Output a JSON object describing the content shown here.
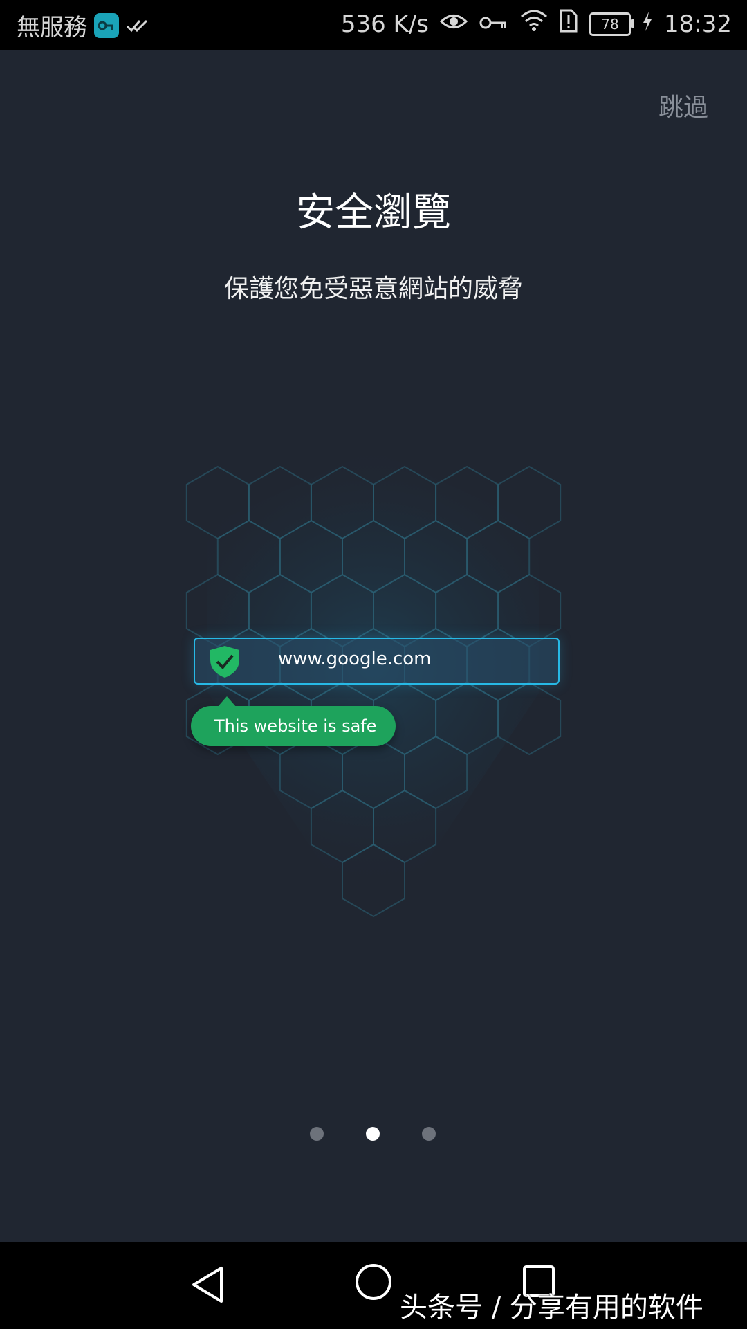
{
  "status_bar": {
    "carrier": "無服務",
    "network_speed": "536 K/s",
    "battery_level": "78",
    "time": "18:32",
    "icons": [
      "vpn-key-icon",
      "double-check-icon",
      "eye-icon",
      "key-icon",
      "wifi-icon",
      "alert-sim-icon",
      "battery-icon",
      "charging-icon"
    ]
  },
  "onboarding": {
    "skip_label": "跳過",
    "title": "安全瀏覽",
    "subtitle": "保護您免受惡意網站的威脅",
    "illustration": {
      "url": "www.google.com",
      "tooltip": "This website is safe"
    },
    "pager": {
      "total_pages": 3,
      "active_page": 2
    }
  },
  "navigation_bar": {
    "buttons": [
      "back-icon",
      "home-icon",
      "recents-icon"
    ]
  },
  "watermark": "头条号 / 分享有用的软件",
  "colors": {
    "background": "#202631",
    "accent_blue": "#27b9e6",
    "safe_green": "#1ea35c",
    "dot_inactive": "#6d727b",
    "dot_active": "#ffffff"
  }
}
